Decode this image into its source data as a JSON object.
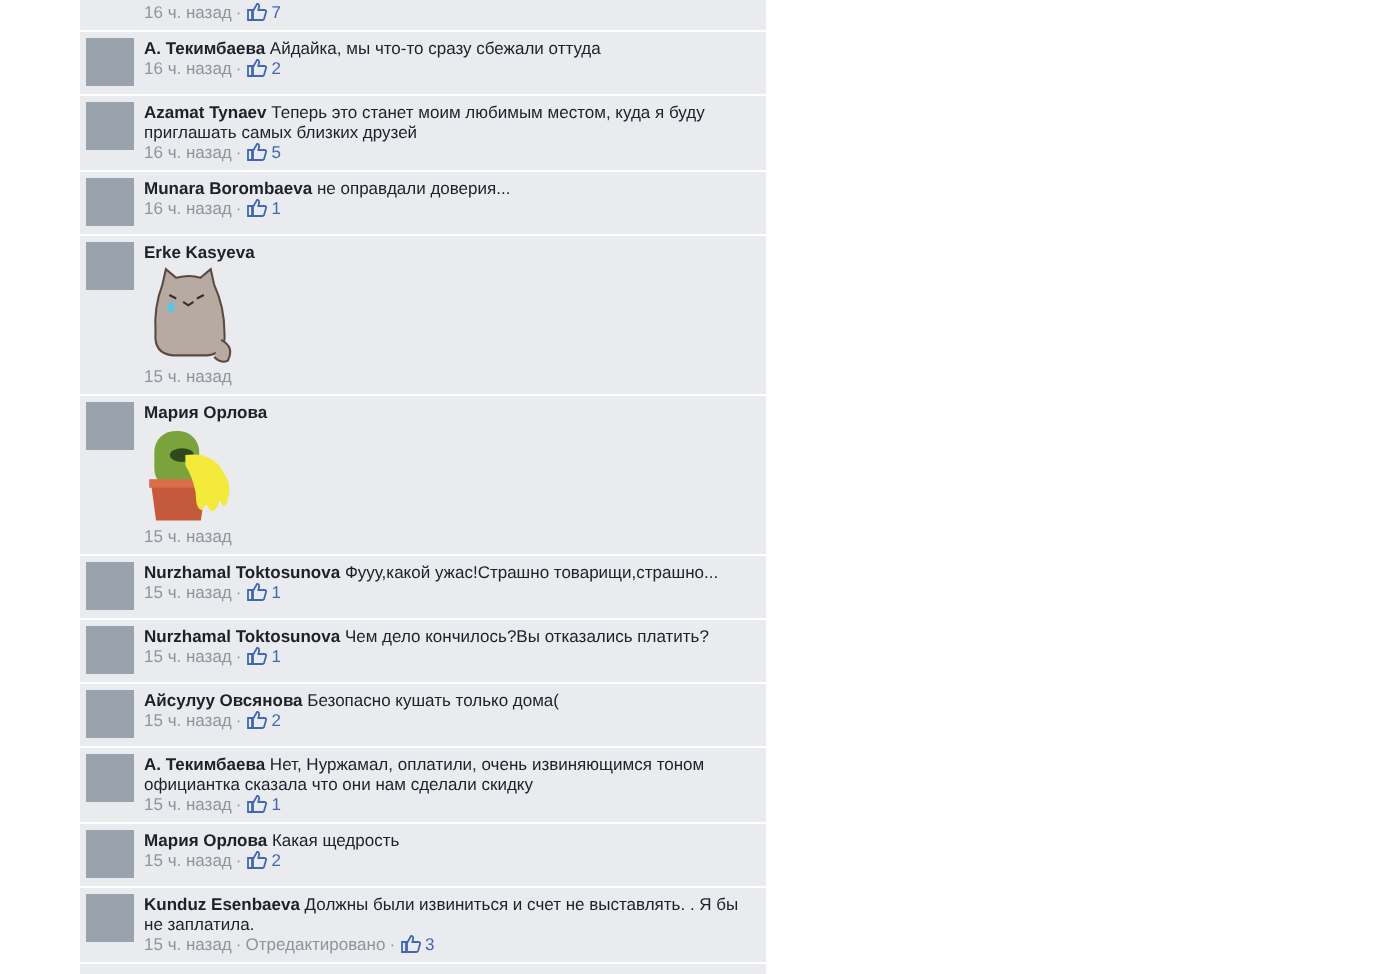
{
  "comments": [
    {
      "kind": "text",
      "time": "16 ч. назад",
      "separators": [
        "·"
      ],
      "likes": "7"
    },
    {
      "kind": "text",
      "author": "А. Текимбаева",
      "text": "Айдайка, мы что-то сразу сбежали оттуда",
      "time": "16 ч. назад",
      "separators": [
        "·"
      ],
      "likes": "2"
    },
    {
      "kind": "text",
      "author": "Azamat Tynaev",
      "text": "Теперь это станет моим любимым местом, куда я буду приглашать самых близких друзей",
      "time": "16 ч. назад",
      "separators": [
        "·"
      ],
      "likes": "5"
    },
    {
      "kind": "text",
      "author": "Munara Borombaeva",
      "text": "не оправдали доверия...",
      "time": "16 ч. назад",
      "separators": [
        "·"
      ],
      "likes": "1"
    },
    {
      "kind": "cat",
      "author": "Erke Kasyeva",
      "time": "15 ч. назад"
    },
    {
      "kind": "cactus",
      "author": "Мария Орлова",
      "time": "15 ч. назад"
    },
    {
      "kind": "text",
      "author": "Nurzhamal Toktosunova",
      "text": "Фууу,какой ужас!Страшно товарищи,страшно...",
      "time": "15 ч. назад",
      "separators": [
        "·"
      ],
      "likes": "1"
    },
    {
      "kind": "text",
      "author": "Nurzhamal Toktosunova",
      "text": "Чем дело кончилось?Вы отказались платить?",
      "time": "15 ч. назад",
      "separators": [
        "·"
      ],
      "likes": "1"
    },
    {
      "kind": "text",
      "author": "Айсулуу Овсянова",
      "text": "Безопасно кушать только дома(",
      "time": "15 ч. назад",
      "separators": [
        "·"
      ],
      "likes": "2"
    },
    {
      "kind": "text",
      "author": "А. Текимбаева",
      "text": "Нет, Нуржамал, оплатили, очень извиняющимся тоном официантка сказала что они нам сделали скидку",
      "time": "15 ч. назад",
      "separators": [
        "·"
      ],
      "likes": "1"
    },
    {
      "kind": "text",
      "author": "Мария Орлова",
      "text": "Какая щедрость",
      "time": "15 ч. назад",
      "separators": [
        "·"
      ],
      "likes": "2"
    },
    {
      "kind": "text",
      "author": "Kunduz Esenbaeva",
      "text": "Должны были извиниться и счет не выставлять. . Я бы не заплатила.",
      "time": "15 ч. назад",
      "edited": "Отредактировано",
      "separators": [
        "·",
        "·"
      ],
      "likes": "3"
    }
  ]
}
